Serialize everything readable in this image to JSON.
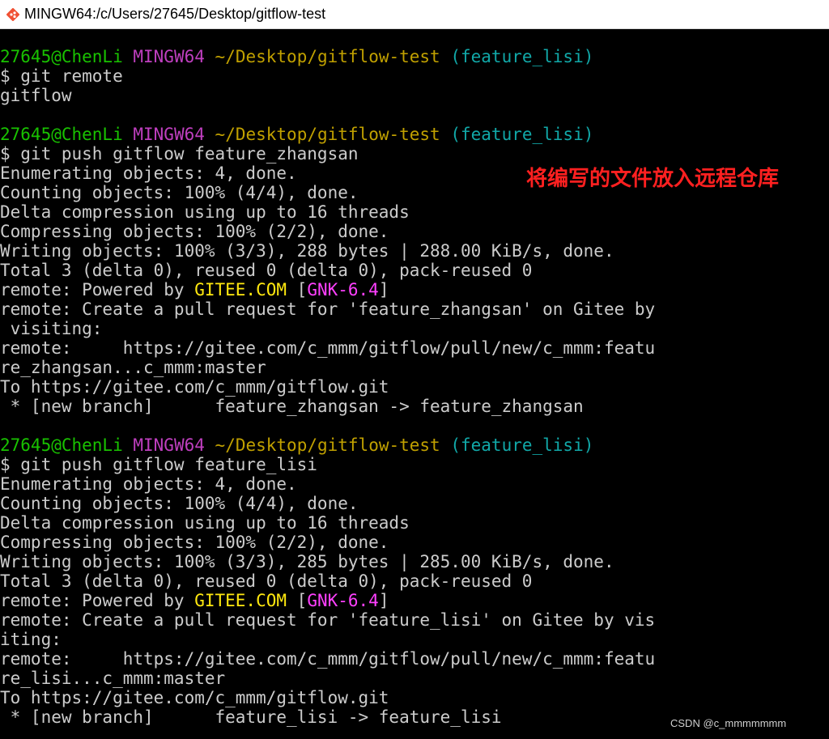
{
  "window": {
    "title": "MINGW64:/c/Users/27645/Desktop/gitflow-test",
    "icon": "git-bash-icon"
  },
  "prompt": {
    "user_host": "27645@ChenLi",
    "system": "MINGW64",
    "path": "~/Desktop/gitflow-test",
    "branch": "(feature_lisi)"
  },
  "annotation": "将编写的文件放入远程仓库",
  "watermark": "CSDN @c_mmmmmmm",
  "terminal": {
    "block1": {
      "cmd": "$ git remote",
      "out": "gitflow"
    },
    "block2": {
      "cmd": "$ git push gitflow feature_zhangsan",
      "l1": "Enumerating objects: 4, done.",
      "l2": "Counting objects: 100% (4/4), done.",
      "l3": "Delta compression using up to 16 threads",
      "l4": "Compressing objects: 100% (2/2), done.",
      "l5": "Writing objects: 100% (3/3), 288 bytes | 288.00 KiB/s, done.",
      "l6": "Total 3 (delta 0), reused 0 (delta 0), pack-reused 0",
      "powered_prefix": "remote: Powered by ",
      "gitee": "GITEE.COM",
      "lbr": " [",
      "gnk": "GNK-6.4",
      "rbr": "]",
      "l8": "remote: Create a pull request for 'feature_zhangsan' on Gitee by",
      "l9": " visiting:",
      "l10": "remote:     https://gitee.com/c_mmm/gitflow/pull/new/c_mmm:featu",
      "l11": "re_zhangsan...c_mmm:master",
      "l12": "To https://gitee.com/c_mmm/gitflow.git",
      "l13": " * [new branch]      feature_zhangsan -> feature_zhangsan"
    },
    "block3": {
      "cmd": "$ git push gitflow feature_lisi",
      "l1": "Enumerating objects: 4, done.",
      "l2": "Counting objects: 100% (4/4), done.",
      "l3": "Delta compression using up to 16 threads",
      "l4": "Compressing objects: 100% (2/2), done.",
      "l5": "Writing objects: 100% (3/3), 285 bytes | 285.00 KiB/s, done.",
      "l6": "Total 3 (delta 0), reused 0 (delta 0), pack-reused 0",
      "powered_prefix": "remote: Powered by ",
      "gitee": "GITEE.COM",
      "lbr": " [",
      "gnk": "GNK-6.4",
      "rbr": "]",
      "l8": "remote: Create a pull request for 'feature_lisi' on Gitee by vis",
      "l9": "iting:",
      "l10": "remote:     https://gitee.com/c_mmm/gitflow/pull/new/c_mmm:featu",
      "l11": "re_lisi...c_mmm:master",
      "l12": "To https://gitee.com/c_mmm/gitflow.git",
      "l13": " * [new branch]      feature_lisi -> feature_lisi"
    }
  }
}
